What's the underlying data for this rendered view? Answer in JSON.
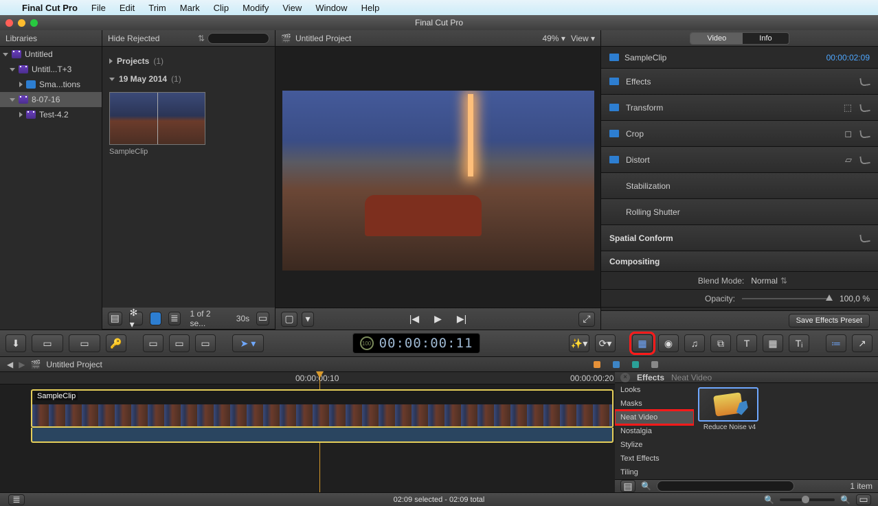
{
  "menubar": {
    "app": "Final Cut Pro",
    "items": [
      "File",
      "Edit",
      "Trim",
      "Mark",
      "Clip",
      "Modify",
      "View",
      "Window",
      "Help"
    ]
  },
  "window": {
    "title": "Final Cut Pro"
  },
  "libraries": {
    "header": "Libraries",
    "items": [
      "Untitled",
      "Untitl...T+3",
      "Sma...tions",
      "8-07-16",
      "Test-4.2"
    ]
  },
  "browser": {
    "header": {
      "hide": "Hide Rejected"
    },
    "group1": {
      "label": "Projects",
      "count": "(1)"
    },
    "group2": {
      "label": "19 May 2014",
      "count": "(1)"
    },
    "thumb": "SampleClip",
    "toolbar": {
      "status": "1 of 2 se...",
      "zoom": "30s"
    }
  },
  "viewer": {
    "title": "Untitled Project",
    "zoom": "49%",
    "view": "View"
  },
  "inspector": {
    "tabs": {
      "video": "Video",
      "info": "Info"
    },
    "clip": "SampleClip",
    "tc": "00:00:02:09",
    "rows": [
      "Effects",
      "Transform",
      "Crop",
      "Distort",
      "Stabilization",
      "Rolling Shutter",
      "Spatial Conform",
      "Compositing"
    ],
    "blend": {
      "label": "Blend Mode:",
      "value": "Normal"
    },
    "opacity": {
      "label": "Opacity:",
      "value": "100,0 %"
    },
    "save": "Save Effects Preset"
  },
  "timecode": "00:00:00:11",
  "timeline": {
    "project": "Untitled Project",
    "ruler": {
      "t1": "00:00:00:10",
      "t2": "00:00:00:20"
    },
    "clip": "SampleClip"
  },
  "effects": {
    "title": "Effects",
    "sub": "Neat Video",
    "cats": [
      "Looks",
      "Masks",
      "Neat Video",
      "Nostalgia",
      "Stylize",
      "Text Effects",
      "Tiling"
    ],
    "thumb": "Reduce Noise v4",
    "count": "1 item"
  },
  "status": {
    "text": "02:09 selected - 02:09 total"
  }
}
